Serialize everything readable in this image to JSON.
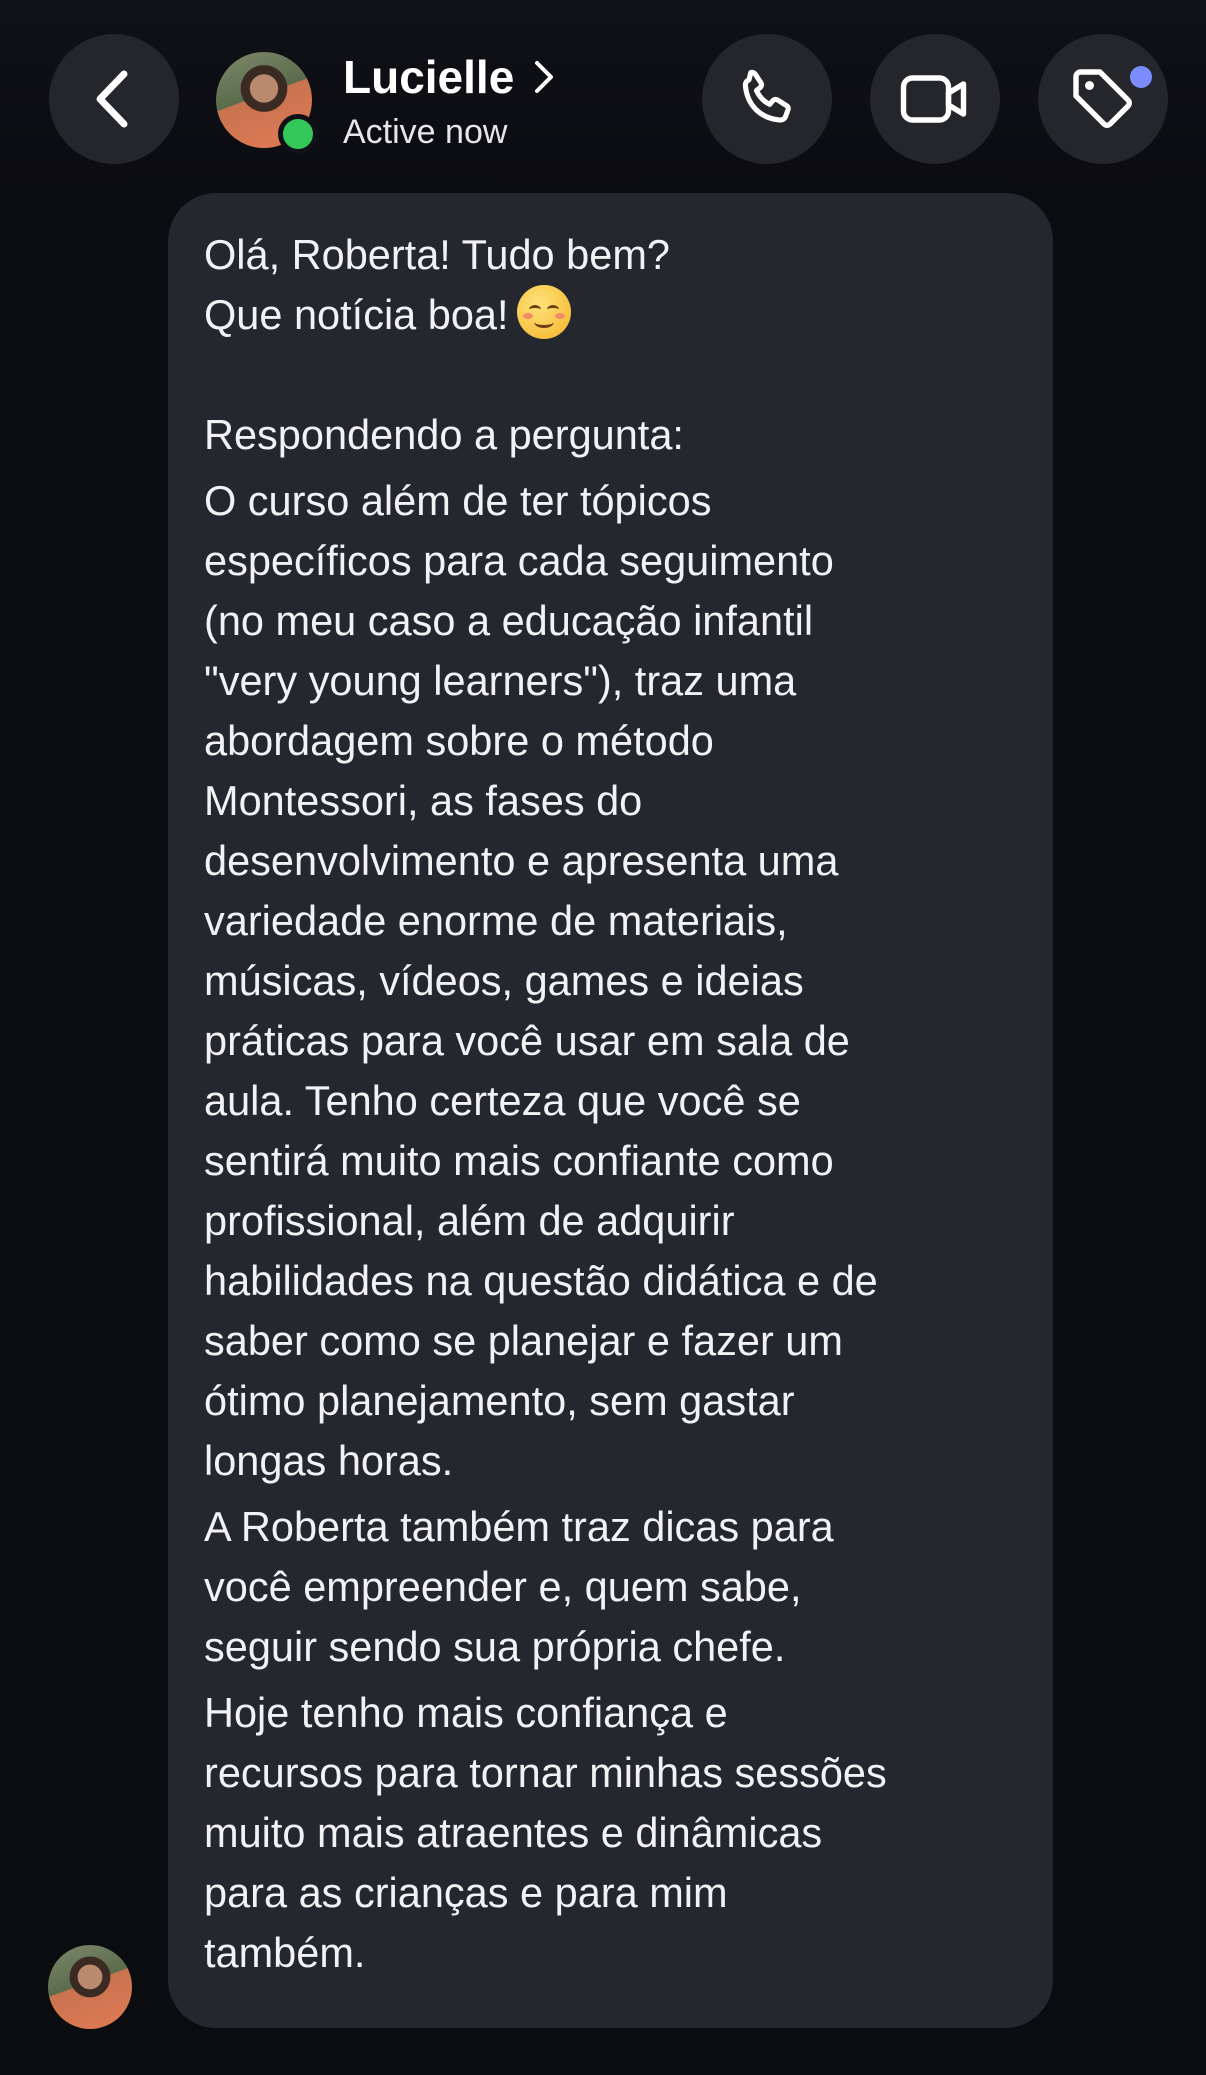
{
  "header": {
    "contact_name": "Lucielle",
    "status": "Active now",
    "chevron": "chevron-right-icon",
    "buttons": {
      "back": "chevron-left-icon",
      "call": "phone-icon",
      "video": "video-camera-icon",
      "tag": "tag-icon"
    },
    "colors": {
      "online": "#34c759",
      "notification": "#7b8cff"
    }
  },
  "message": {
    "greeting_line1": "Olá, Roberta! Tudo bem?",
    "greeting_line2": "Que notícia boa!",
    "greeting_emoji": "smiling-face-icon",
    "paragraph1": "Respondendo a pergunta:",
    "paragraph2": "O curso além de ter tópicos\nespecíficos para cada seguimento\n(no meu caso a educação infantil\n\"very young learners\"), traz uma\nabordagem sobre o método\nMontessori, as fases do\ndesenvolvimento e apresenta uma\nvariedade enorme de materiais,\nmúsicas, vídeos, games e ideias\npráticas para você usar em sala de\naula. Tenho certeza que você se\nsentirá muito mais confiante como\nprofissional, além de adquirir\nhabilidades na questão didática e de\nsaber como se planejar e fazer um\nótimo planejamento, sem gastar\nlongas horas.",
    "paragraph3": "A Roberta também traz dicas para\nvocê empreender e, quem sabe,\nseguir sendo sua própria chefe.",
    "paragraph4": "Hoje tenho mais confiança e\nrecursos para tornar minhas sessões\nmuito mais atraentes e dinâmicas\npara as crianças e para mim\ntambém."
  },
  "colors": {
    "background": "#0b0c10",
    "bubble": "#25272e",
    "button": "#24262c"
  }
}
